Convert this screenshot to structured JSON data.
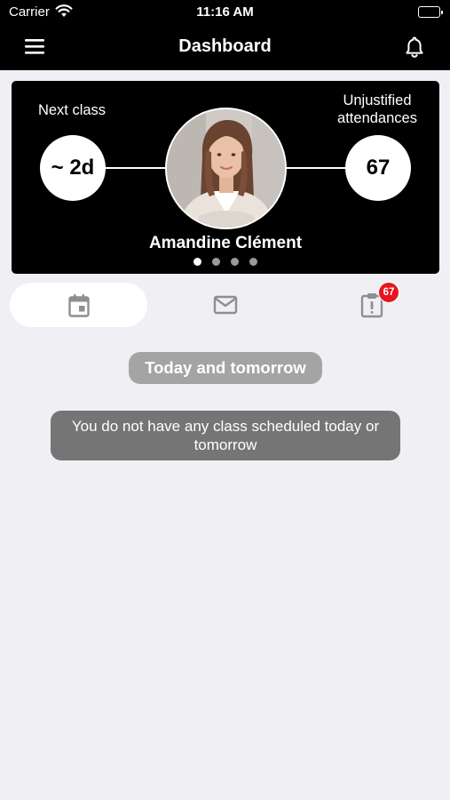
{
  "status_bar": {
    "carrier": "Carrier",
    "time": "11:16 AM",
    "wifi_icon": "wifi-icon",
    "battery_icon": "battery-icon"
  },
  "nav": {
    "title": "Dashboard",
    "menu_icon": "hamburger-menu-icon",
    "bell_icon": "bell-icon"
  },
  "profile_card": {
    "next_class_label": "Next class",
    "next_class_value": "~ 2d",
    "unjustified_label": "Unjustified attendances",
    "unjustified_value": "67",
    "student_name": "Amandine Clément",
    "page_count": 4,
    "active_page": 1
  },
  "tabs": [
    {
      "icon": "calendar-icon",
      "active": true
    },
    {
      "icon": "mail-icon",
      "active": false
    },
    {
      "icon": "alert-clipboard-icon",
      "active": false,
      "badge": "67"
    }
  ],
  "section": {
    "title": "Today and tomorrow",
    "empty_message": "You do not have any class scheduled today or tomorrow"
  },
  "colors": {
    "header": "#000000",
    "background": "#efeff4",
    "badge": "#e8141e"
  }
}
